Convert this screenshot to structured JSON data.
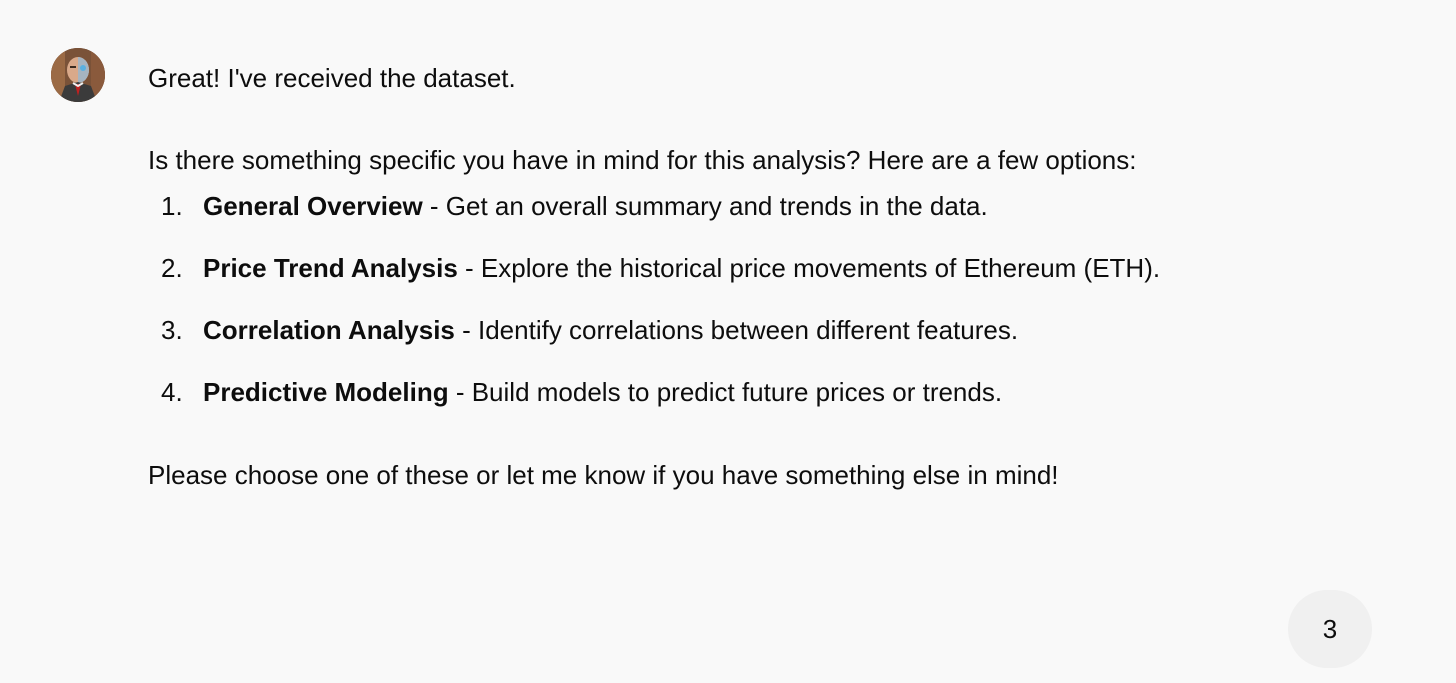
{
  "assistant": {
    "avatar_icon": "bot-avatar-icon",
    "greeting": "Great! I've received the dataset.",
    "intro": "Is there something specific you have in mind for this analysis? Here are a few options:",
    "options": [
      {
        "number": "1.",
        "title": "General Overview",
        "description": " - Get an overall summary and trends in the data."
      },
      {
        "number": "2.",
        "title": "Price Trend Analysis",
        "description": " - Explore the historical price movements of Ethereum (ETH)."
      },
      {
        "number": "3.",
        "title": "Correlation Analysis",
        "description": " - Identify correlations between different features."
      },
      {
        "number": "4.",
        "title": "Predictive Modeling",
        "description": " - Build models to predict future prices or trends."
      }
    ],
    "closing": "Please choose one of these or let me know if you have something else in mind!"
  },
  "user": {
    "reply": "3"
  }
}
